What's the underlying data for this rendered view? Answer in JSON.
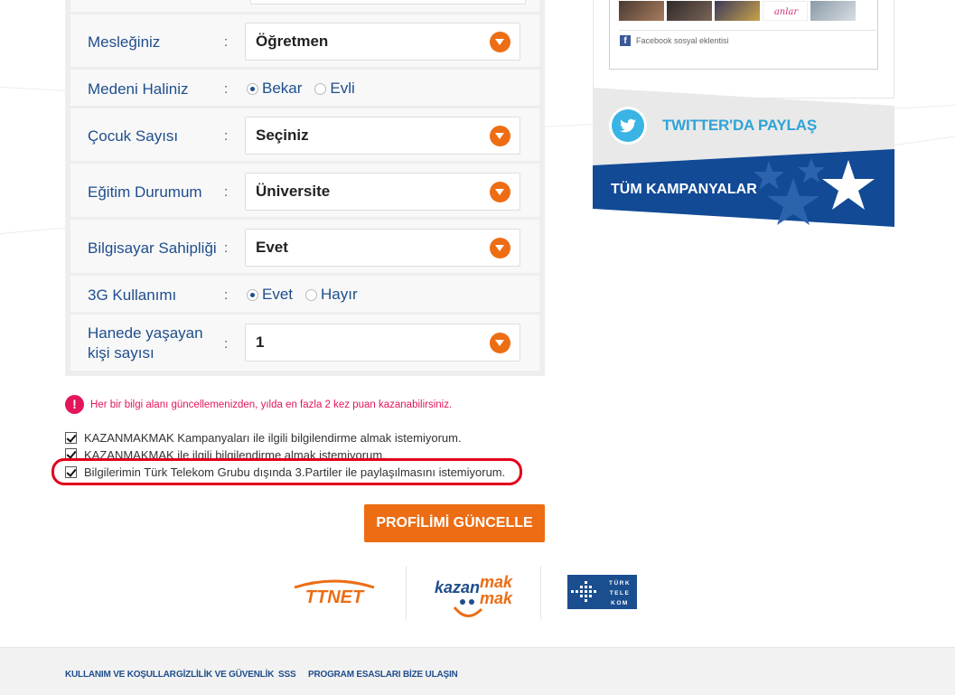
{
  "form": {
    "rows": [
      {
        "label": "Mesleğiniz",
        "type": "select",
        "value": "Öğretmen"
      },
      {
        "label": "Medeni Haliniz",
        "type": "radio",
        "options": [
          {
            "label": "Bekar",
            "checked": true
          },
          {
            "label": "Evli",
            "checked": false
          }
        ]
      },
      {
        "label": "Çocuk Sayısı",
        "type": "select",
        "value": "Seçiniz"
      },
      {
        "label": "Eğitim Durumum",
        "type": "select",
        "value": "Üniversite"
      },
      {
        "label": "Bilgisayar Sahipliği",
        "type": "select",
        "value": "Evet"
      },
      {
        "label": "3G Kullanımı",
        "type": "radio",
        "options": [
          {
            "label": "Evet",
            "checked": true
          },
          {
            "label": "Hayır",
            "checked": false
          }
        ]
      },
      {
        "label_line1": "Hanede yaşayan",
        "label_line2": "kişi sayısı",
        "type": "select",
        "value": "1"
      }
    ],
    "colon": ":"
  },
  "notice": {
    "icon": "exclamation-icon",
    "text": "Her bir bilgi alanı güncellemenizden, yılda en fazla 2 kez puan kazanabilirsiniz."
  },
  "consents": [
    {
      "label": "KAZANMAKMAK Kampanyaları ile ilgili bilgilendirme almak istemiyorum.",
      "checked": true
    },
    {
      "label": "KAZANMAKMAK ile ilgili bilgilendirme almak istemiyorum.",
      "checked": true
    },
    {
      "label": "Bilgilerimin Türk Telekom Grubu dışında 3.Partiler ile paylaşılmasını istemiyorum.",
      "checked": true
    }
  ],
  "update_button": "PROFİLİMİ GÜNCELLE",
  "logos": {
    "ttnet": "TTNET",
    "kazanmakmak_line1": "kazan",
    "kazanmakmak_mak1": "mak",
    "kazanmakmak_mak2": "mak",
    "turk_telekom": [
      "TÜRK",
      "TELE",
      "KOM"
    ]
  },
  "footer": {
    "links": [
      "KULLANIM VE KOŞULLAR",
      "GİZLİLİK VE GÜVENLİK",
      "SSS",
      "PROGRAM ESASLARI",
      "BİZE ULAŞIN"
    ]
  },
  "sidebar": {
    "facebook_plugin": "Facebook sosyal eklentisi",
    "twitter_label": "TWITTER'DA PAYLAŞ",
    "campaigns_label": "TÜM KAMPANYALAR"
  },
  "colors": {
    "accent_orange": "#ec6d14",
    "brand_blue": "#1f4e8c",
    "campaign_blue": "#124a96",
    "twitter_blue": "#39b4e4",
    "notice_pink": "#e3165b",
    "highlight_red": "#e2001a"
  }
}
